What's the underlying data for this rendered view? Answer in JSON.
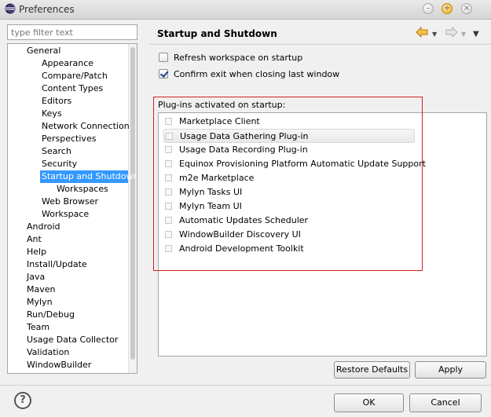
{
  "window": {
    "title": "Preferences"
  },
  "filter": {
    "placeholder": "type filter text"
  },
  "tree": {
    "items": [
      {
        "label": "General",
        "level": 0
      },
      {
        "label": "Appearance",
        "level": 1
      },
      {
        "label": "Compare/Patch",
        "level": 1
      },
      {
        "label": "Content Types",
        "level": 1
      },
      {
        "label": "Editors",
        "level": 1
      },
      {
        "label": "Keys",
        "level": 1
      },
      {
        "label": "Network Connection",
        "level": 1
      },
      {
        "label": "Perspectives",
        "level": 1
      },
      {
        "label": "Search",
        "level": 1
      },
      {
        "label": "Security",
        "level": 1
      },
      {
        "label": "Startup and Shutdown",
        "level": 1,
        "selected": true
      },
      {
        "label": "Workspaces",
        "level": 2
      },
      {
        "label": "Web Browser",
        "level": 1
      },
      {
        "label": "Workspace",
        "level": 1
      },
      {
        "label": "Android",
        "level": 0
      },
      {
        "label": "Ant",
        "level": 0
      },
      {
        "label": "Help",
        "level": 0
      },
      {
        "label": "Install/Update",
        "level": 0
      },
      {
        "label": "Java",
        "level": 0
      },
      {
        "label": "Maven",
        "level": 0
      },
      {
        "label": "Mylyn",
        "level": 0
      },
      {
        "label": "Run/Debug",
        "level": 0
      },
      {
        "label": "Team",
        "level": 0
      },
      {
        "label": "Usage Data Collector",
        "level": 0
      },
      {
        "label": "Validation",
        "level": 0
      },
      {
        "label": "WindowBuilder",
        "level": 0
      }
    ]
  },
  "page": {
    "title": "Startup and Shutdown",
    "refresh_label": "Refresh workspace on startup",
    "refresh_checked": false,
    "confirm_label": "Confirm exit when closing last window",
    "confirm_checked": true,
    "plugins_label": "Plug-ins activated on startup:",
    "plugins": [
      {
        "label": "Marketplace Client",
        "checked": false
      },
      {
        "label": "Usage Data Gathering Plug-in",
        "checked": false,
        "highlighted": true
      },
      {
        "label": "Usage Data Recording Plug-in",
        "checked": false
      },
      {
        "label": "Equinox Provisioning Platform Automatic Update Support",
        "checked": false
      },
      {
        "label": "m2e Marketplace",
        "checked": false
      },
      {
        "label": "Mylyn Tasks UI",
        "checked": false
      },
      {
        "label": "Mylyn Team UI",
        "checked": false
      },
      {
        "label": "Automatic Updates Scheduler",
        "checked": false
      },
      {
        "label": "WindowBuilder Discovery UI",
        "checked": false
      },
      {
        "label": "Android Development Toolkit",
        "checked": false
      }
    ],
    "restore_defaults": "Restore Defaults",
    "apply": "Apply"
  },
  "footer": {
    "help": "?",
    "ok": "OK",
    "cancel": "Cancel"
  },
  "colors": {
    "selection": "#3399ff",
    "annotation_box": "#d62020",
    "back_arrow": "#e8a21a"
  },
  "icons": {
    "app": "eclipse-icon",
    "back": "back-arrow-icon",
    "forward": "forward-arrow-icon",
    "menu": "view-menu-icon",
    "help": "help-icon"
  }
}
